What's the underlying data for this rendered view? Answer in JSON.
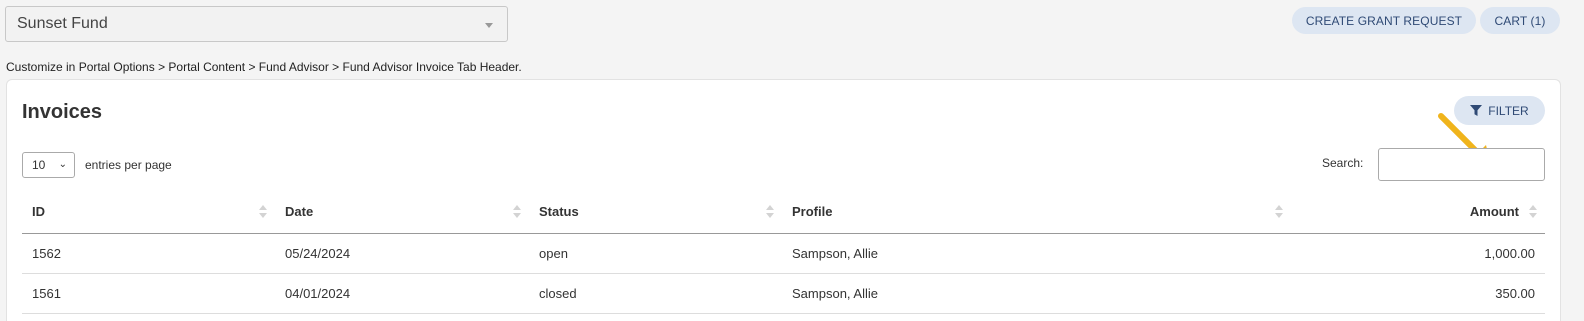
{
  "fund_selector": {
    "value": "Sunset Fund"
  },
  "header_buttons": {
    "create_grant_request": "CREATE GRANT REQUEST",
    "cart": "CART (1)"
  },
  "customize_note": "Customize in Portal Options > Portal Content > Fund Advisor > Fund Advisor Invoice Tab Header.",
  "invoices": {
    "title": "Invoices",
    "filter_label": "FILTER",
    "entries": {
      "value": "10",
      "label": "entries per page"
    },
    "search": {
      "label": "Search:",
      "value": ""
    },
    "columns": [
      "ID",
      "Date",
      "Status",
      "Profile",
      "Amount"
    ],
    "rows": [
      {
        "id": "1562",
        "date": "05/24/2024",
        "status": "open",
        "profile": "Sampson, Allie",
        "amount": "1,000.00"
      },
      {
        "id": "1561",
        "date": "04/01/2024",
        "status": "closed",
        "profile": "Sampson, Allie",
        "amount": "350.00"
      }
    ]
  },
  "colors": {
    "accent_bg": "#dde6f2",
    "accent_text": "#2f4a75",
    "annotation_arrow": "#f0b41c"
  },
  "icons": {
    "filter": "funnel-icon",
    "sort": "sort-arrows-icon",
    "annotation": "arrow-annotation-icon"
  }
}
